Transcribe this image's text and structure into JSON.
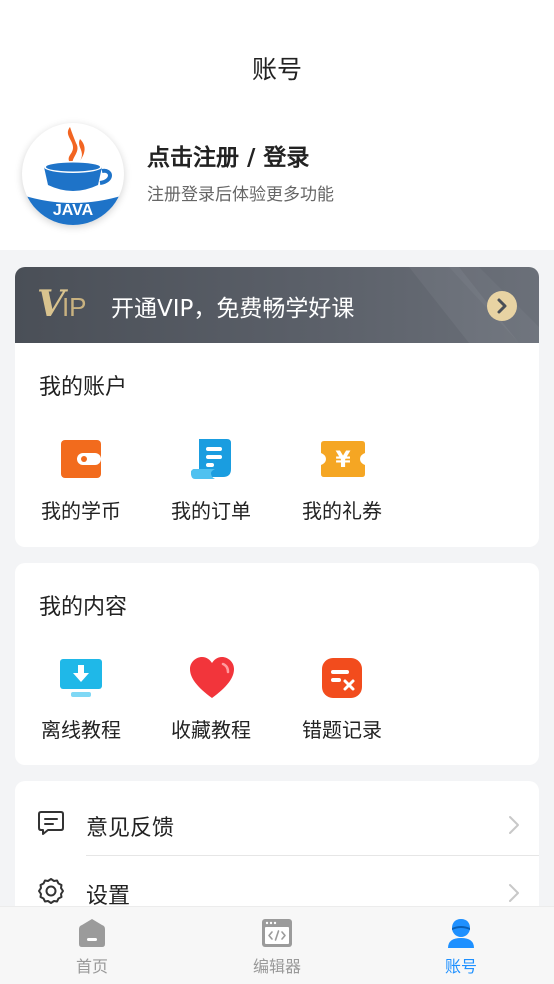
{
  "header": {
    "title": "账号"
  },
  "profile": {
    "name": "点击注册 / 登录",
    "subtitle": "注册登录后体验更多功能",
    "avatar_label": "JAVA"
  },
  "vip": {
    "logo_v": "V",
    "logo_ip": "IP",
    "text": "开通VIP，免费畅学好课",
    "accent": "#d9c38e"
  },
  "account": {
    "title": "我的账户",
    "items": [
      {
        "label": "我的学币",
        "icon": "wallet-icon",
        "color": "#f26b1d"
      },
      {
        "label": "我的订单",
        "icon": "receipt-icon",
        "color": "#1a9de0"
      },
      {
        "label": "我的礼券",
        "icon": "coupon-icon",
        "color": "#f5a623"
      }
    ]
  },
  "content": {
    "title": "我的内容",
    "items": [
      {
        "label": "离线教程",
        "icon": "download-monitor-icon",
        "color": "#1fb8e8"
      },
      {
        "label": "收藏教程",
        "icon": "heart-icon",
        "color": "#f2353b"
      },
      {
        "label": "错题记录",
        "icon": "wrong-question-icon",
        "color": "#f24c1d"
      }
    ]
  },
  "menu": [
    {
      "label": "意见反馈",
      "icon": "feedback-icon"
    },
    {
      "label": "设置",
      "icon": "settings-gear-icon"
    }
  ],
  "tabbar": {
    "tabs": [
      {
        "label": "首页",
        "icon": "home-icon"
      },
      {
        "label": "编辑器",
        "icon": "code-editor-icon"
      },
      {
        "label": "账号",
        "icon": "user-icon",
        "active": true
      }
    ],
    "active_color": "#1e90ff"
  }
}
